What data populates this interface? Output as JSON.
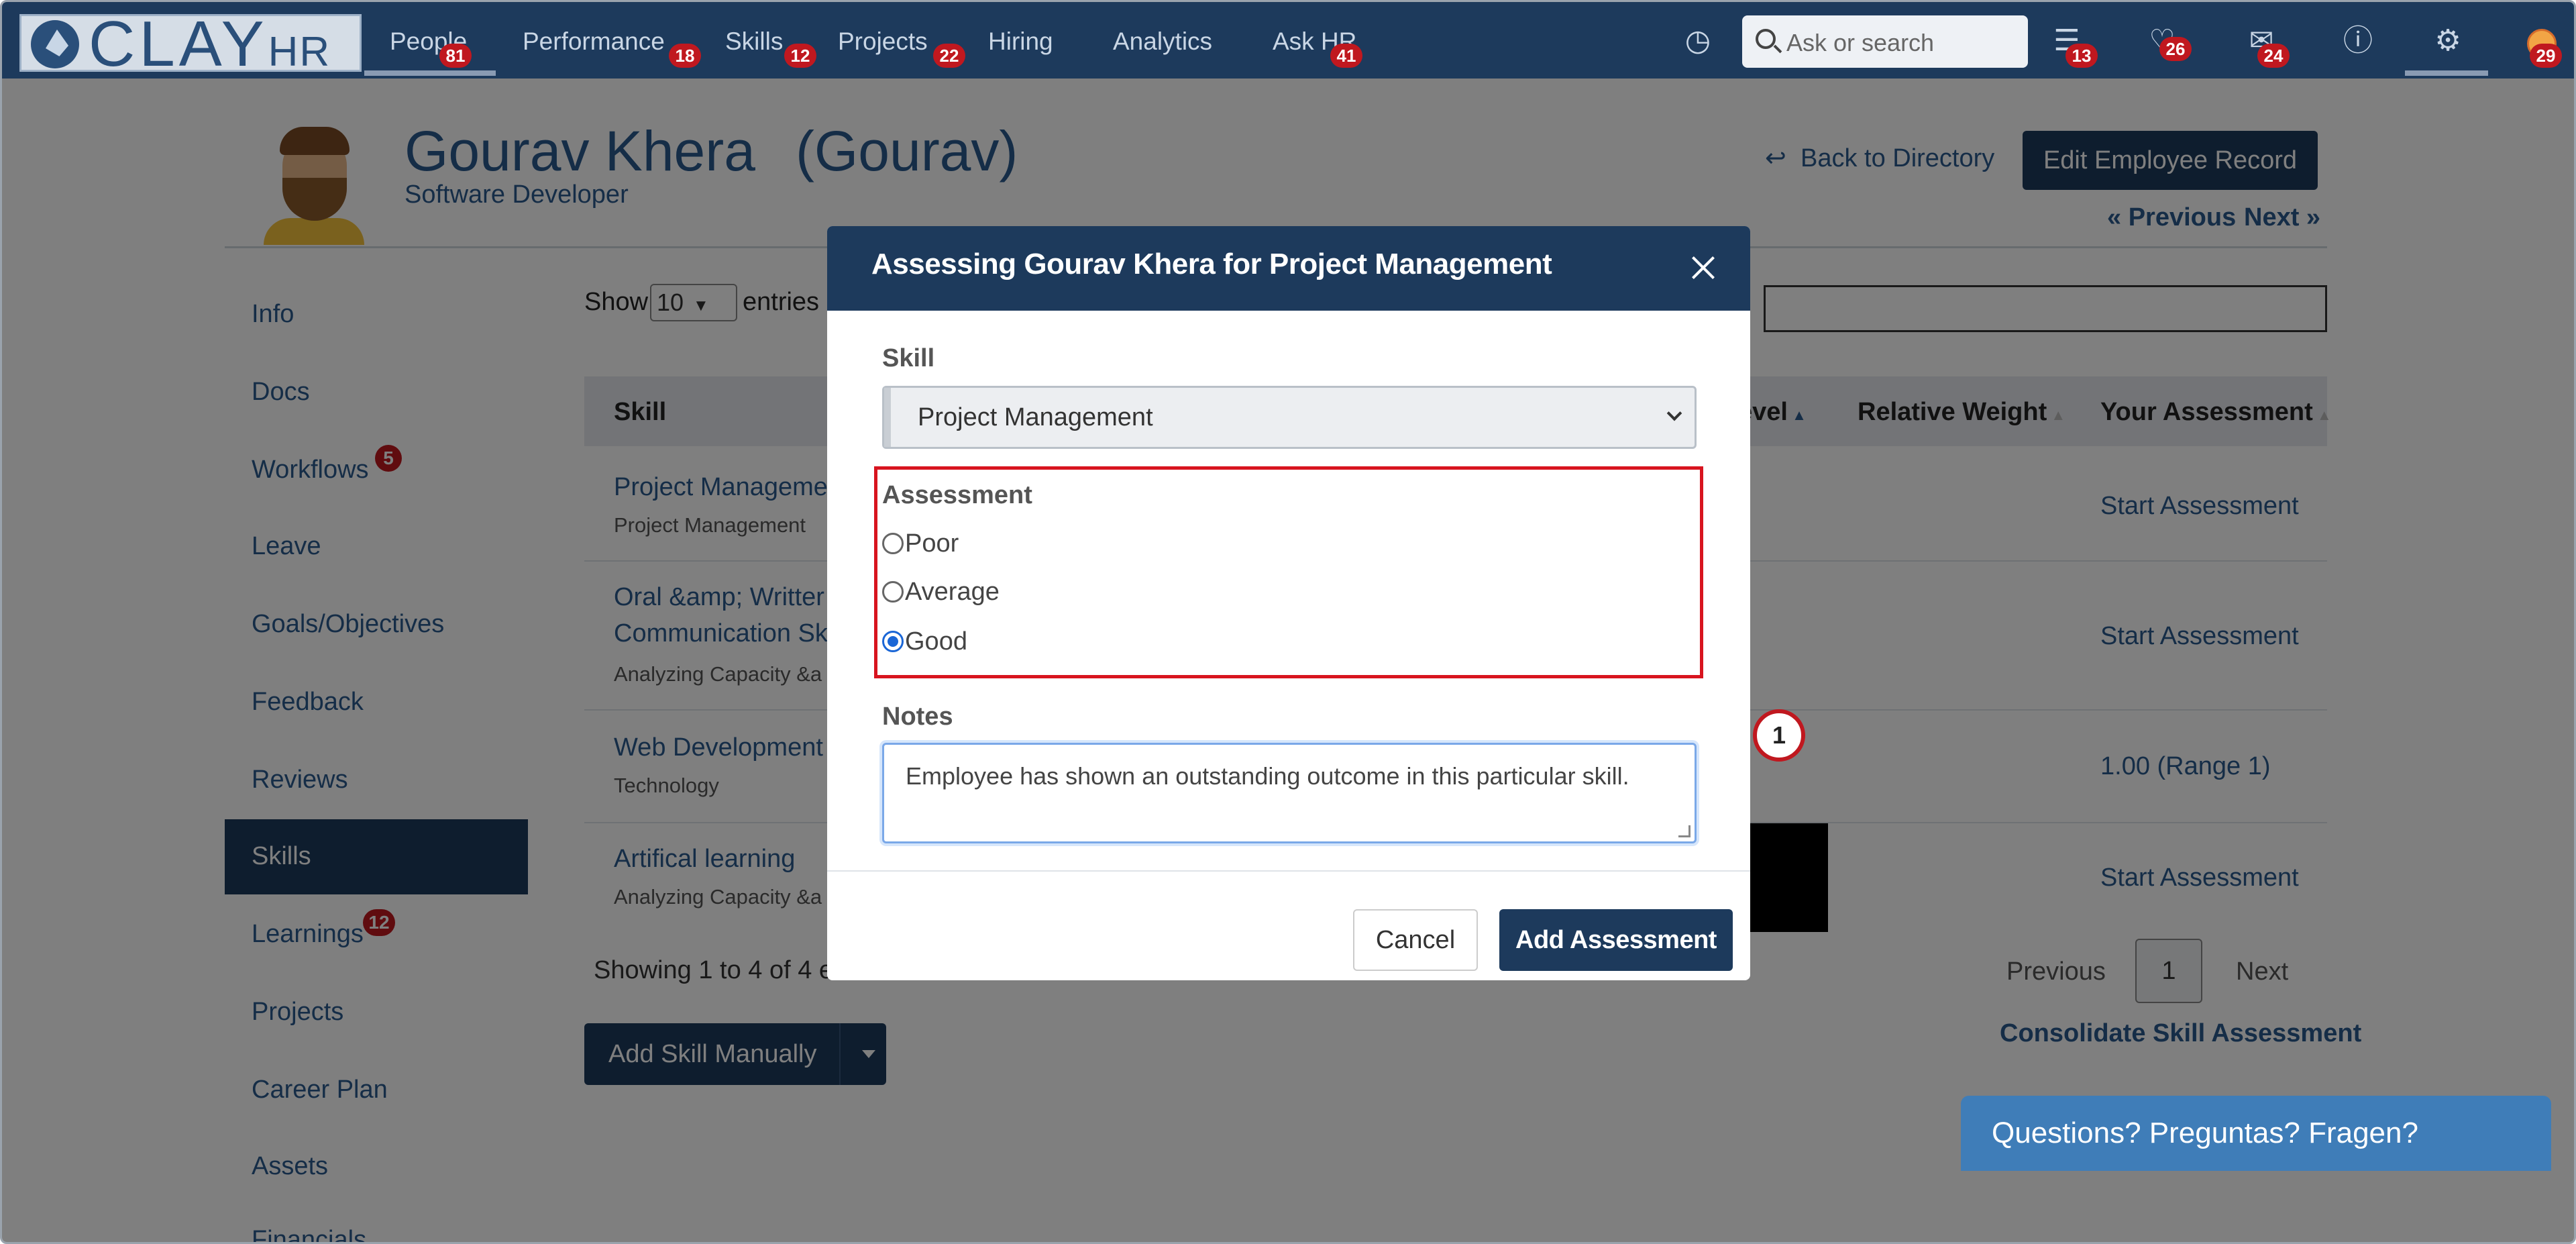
{
  "brand": {
    "logo_main": "CLAY",
    "logo_sub": "HR"
  },
  "nav": {
    "items": [
      {
        "label": "People",
        "badge": "81"
      },
      {
        "label": "Performance",
        "badge": "18"
      },
      {
        "label": "Skills",
        "badge": "12"
      },
      {
        "label": "Projects",
        "badge": "22"
      },
      {
        "label": "Hiring",
        "badge": ""
      },
      {
        "label": "Analytics",
        "badge": ""
      },
      {
        "label": "Ask HR",
        "badge": "41"
      }
    ],
    "search_placeholder": "Ask or search",
    "icon_badges": {
      "learning": "13",
      "notifications": "26",
      "messages": "24",
      "avatar": "29"
    },
    "icons": [
      "alarm-clock-icon",
      "search-icon",
      "learning-icon",
      "bell-icon",
      "mail-icon",
      "help-icon",
      "gear-icon",
      "user-avatar"
    ]
  },
  "employee": {
    "name": "Gourav Khera",
    "nickname": "(Gourav)",
    "title": "Software Developer",
    "back_link": "Back to Directory",
    "edit_button": "Edit Employee Record",
    "previous": "« Previous",
    "next": "Next »"
  },
  "sidebar": {
    "items": [
      {
        "label": "Info",
        "badge": ""
      },
      {
        "label": "Docs",
        "badge": ""
      },
      {
        "label": "Workflows",
        "badge": "5"
      },
      {
        "label": "Leave",
        "badge": ""
      },
      {
        "label": "Goals/Objectives",
        "badge": ""
      },
      {
        "label": "Feedback",
        "badge": ""
      },
      {
        "label": "Reviews",
        "badge": ""
      },
      {
        "label": "Skills",
        "badge": "",
        "active": true
      },
      {
        "label": "Learnings",
        "badge": "12"
      },
      {
        "label": "Projects",
        "badge": ""
      },
      {
        "label": "Career Plan",
        "badge": ""
      },
      {
        "label": "Assets",
        "badge": ""
      },
      {
        "label": "Financials",
        "badge": ""
      }
    ]
  },
  "table": {
    "show_label": "Show",
    "show_value": "10",
    "entries_label": "entries",
    "columns": [
      "Skill",
      "evel",
      "Relative Weight",
      "Your Assessment"
    ],
    "rows": [
      {
        "skill": "Project Manageme",
        "skill_line2": "",
        "category": "Project Management",
        "assessment": "Start Assessment"
      },
      {
        "skill": "Oral &amp; Writter",
        "skill_line2": "Communication Sk",
        "category": "Analyzing Capacity &a",
        "assessment": "Start Assessment"
      },
      {
        "skill": "Web Development",
        "skill_line2": "",
        "category": "Technology",
        "assessment": "1.00 (Range 1)"
      },
      {
        "skill": "Artifical learning",
        "skill_line2": "",
        "category": "Analyzing Capacity &a",
        "assessment": "Start Assessment"
      }
    ],
    "showing": "Showing 1 to 4 of 4 e",
    "pager": {
      "previous": "Previous",
      "page": "1",
      "next": "Next"
    },
    "consolidate": "Consolidate Skill Assessment",
    "add_manual": "Add Skill Manually"
  },
  "modal": {
    "title": "Assessing Gourav Khera for Project Management",
    "skill_label": "Skill",
    "skill_value": "Project Management",
    "assessment_label": "Assessment",
    "options": [
      {
        "label": "Poor",
        "checked": false
      },
      {
        "label": "Average",
        "checked": false
      },
      {
        "label": "Good",
        "checked": true
      }
    ],
    "notes_label": "Notes",
    "notes_value": "Employee has shown an outstanding outcome in this particular skill.",
    "cancel": "Cancel",
    "add": "Add Assessment"
  },
  "marker": "1",
  "chat": "Questions? Preguntas? Fragen?",
  "colors": {
    "nav_bg": "#1d3a5c",
    "link": "#2a5a8f",
    "badge": "#c0181f",
    "highlight": "#d8141f",
    "chat": "#3f7db8"
  }
}
